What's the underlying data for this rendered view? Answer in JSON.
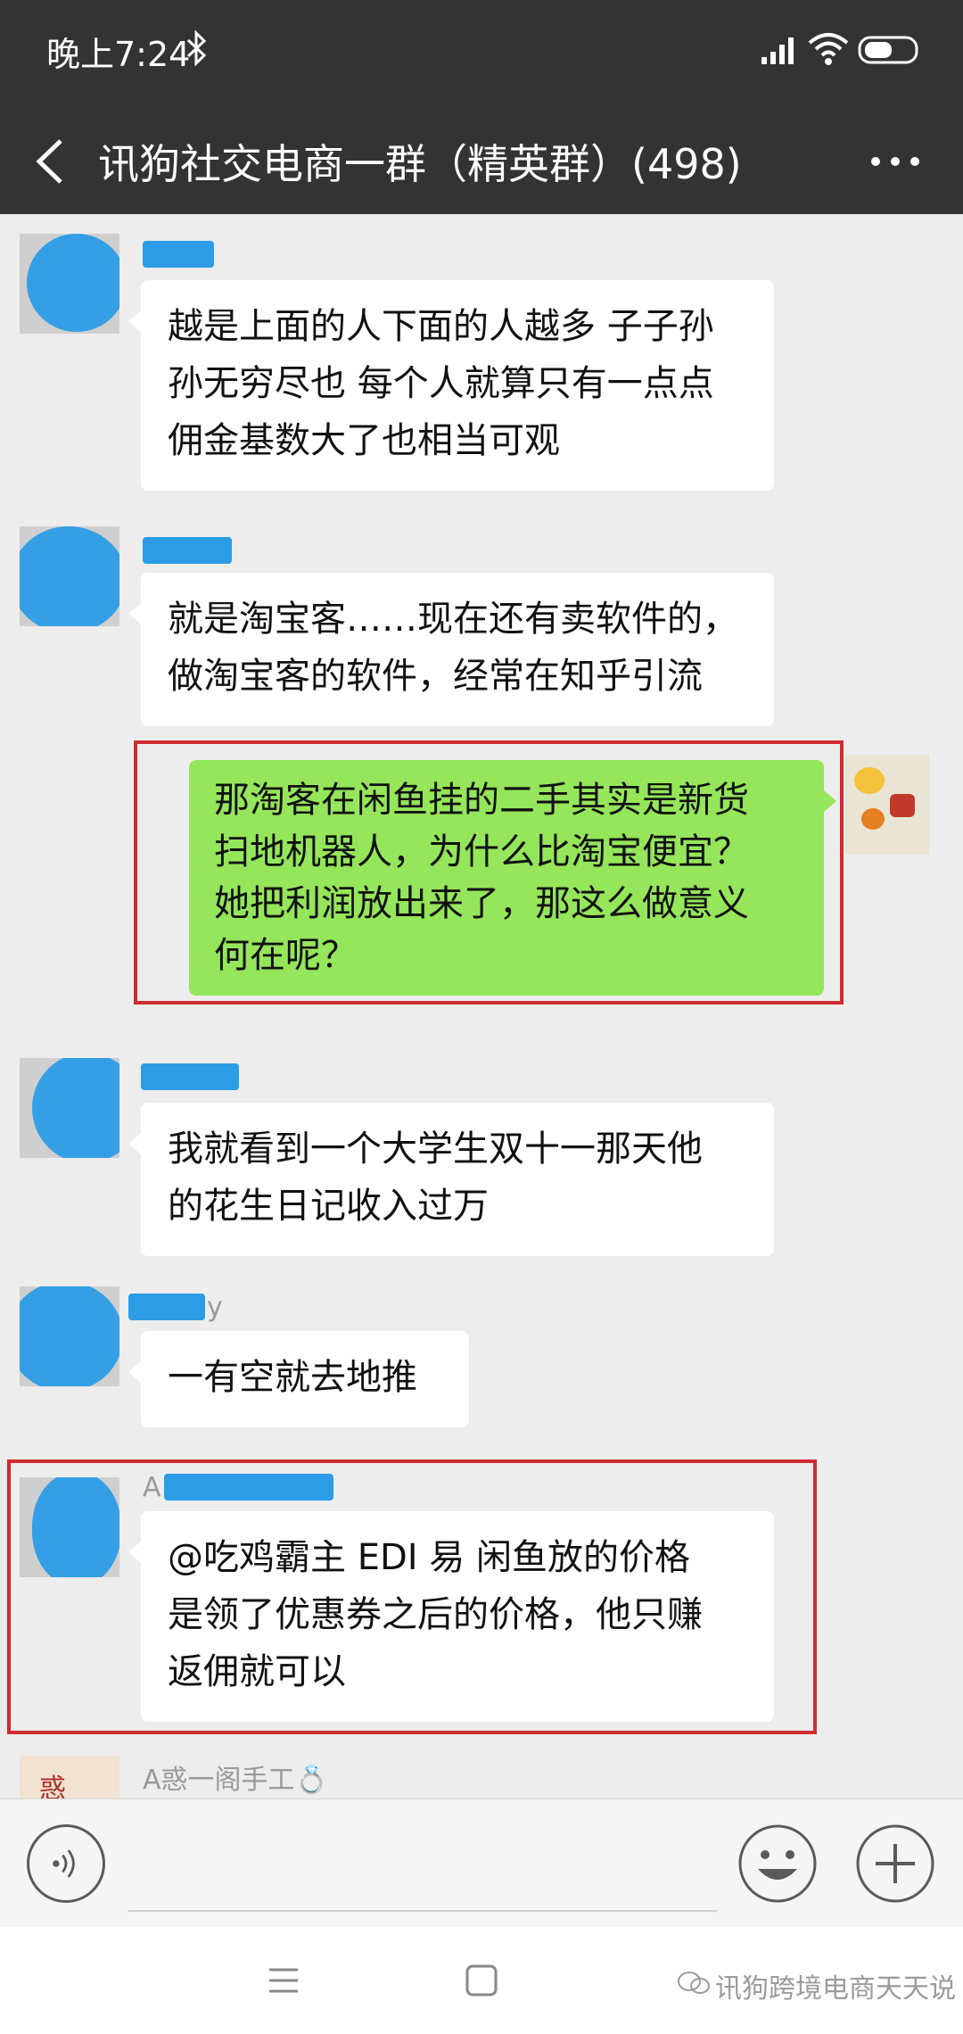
{
  "status_bar": {
    "time": "晚上7:24"
  },
  "header": {
    "title": "讯狗社交电商一群（精英群）(498)"
  },
  "messages": [
    {
      "side": "left",
      "sender": "",
      "lines": [
        "越是上面的人下面的人越多 子子孙",
        "孙无穷尽也 每个人就算只有一点点",
        "佣金基数大了也相当可观"
      ]
    },
    {
      "side": "left",
      "sender": "",
      "lines": [
        "就是淘宝客……现在还有卖软件的，",
        "做淘宝客的软件，经常在知乎引流"
      ]
    },
    {
      "side": "right",
      "sender": "",
      "lines": [
        "那淘客在闲鱼挂的二手其实是新货",
        "扫地机器人，为什么比淘宝便宜？",
        "她把利润放出来了，那这么做意义",
        "何在呢？"
      ]
    },
    {
      "side": "left",
      "sender": "",
      "lines": [
        "我就看到一个大学生双十一那天他",
        "的花生日记收入过万"
      ]
    },
    {
      "side": "left",
      "sender": "y",
      "lines": [
        "一有空就去地推"
      ]
    },
    {
      "side": "left",
      "sender": "A",
      "lines": [
        "@吃鸡霸主 EDI 易  闲鱼放的价格",
        "是领了优惠券之后的价格，他只赚",
        "返佣就可以"
      ]
    },
    {
      "side": "left",
      "sender": "A惑一阁手工💍",
      "lines": []
    }
  ],
  "watermark": {
    "text": "讯狗跨境电商天天说"
  },
  "colors": {
    "header_bg": "#333333",
    "chat_bg": "#ededed",
    "own_bubble": "#95e65a",
    "highlight_border": "#cf2b30",
    "privacy_blur": "#2c9ce6"
  },
  "icons": [
    "bluetooth-icon",
    "signal-icon",
    "wifi-icon",
    "battery-icon",
    "back-arrow-icon",
    "more-icon",
    "voice-icon",
    "emoji-icon",
    "plus-icon",
    "menu-icon",
    "home-icon",
    "back-icon"
  ]
}
